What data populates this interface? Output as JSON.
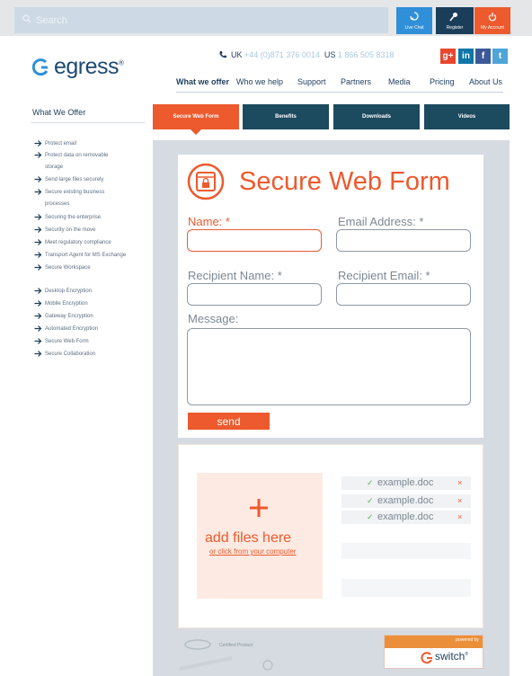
{
  "topbar": {
    "search_placeholder": "Search",
    "live_chat": "Live Chat",
    "register": "Register",
    "my_account": "My Account"
  },
  "header": {
    "logo_text": "egress",
    "phone_uk_label": "UK",
    "phone_uk": "+44 (0)871 376 0014",
    "phone_us_label": "US",
    "phone_us": "1 866 505 8318",
    "social": [
      "g+",
      "in",
      "f",
      "t"
    ]
  },
  "nav": {
    "items": [
      "What we offer",
      "Who we help",
      "Support",
      "Partners",
      "Media",
      "Pricing",
      "About Us"
    ]
  },
  "sidebar": {
    "title": "What We Offer",
    "items": [
      "Protect email",
      "Protect data on removable",
      "storage",
      "Send large files securely",
      "Secure existing business",
      "processes",
      "Securing the enterprise",
      "Security on the move",
      "Meet regulatory compliance",
      "Transport Agent for MS Exchange",
      "Secure Workspace",
      "Desktop Encryption",
      "Mobile Encryption",
      "Gateway Encryption",
      "Automated Encryption",
      "Secure Web Form",
      "Secure Collaboration"
    ]
  },
  "tabs": [
    "Secure Web Form",
    "Benefits",
    "Downloads",
    "Videos"
  ],
  "form": {
    "title": "Secure Web Form",
    "name_label": "Name: *",
    "email_label": "Email Address: *",
    "recipient_name_label": "Recipient Name: *",
    "recipient_email_label": "Recipient Email: *",
    "message_label": "Message:",
    "name_value": "",
    "email_value": "",
    "recipient_name_value": "",
    "recipient_email_value": "",
    "message_value": "",
    "send_label": "send"
  },
  "upload": {
    "add_text": "add files here",
    "add_link": "or click from your computer",
    "files": [
      "example.doc",
      "example.doc",
      "example.doc"
    ],
    "remove_glyph": "×",
    "check_glyph": "✓"
  },
  "footer": {
    "cert_text": "Certified Product",
    "powered_by": "powered by",
    "switch_text": "switch"
  },
  "colors": {
    "accent": "#ec5a2e",
    "navy": "#1c4a5e",
    "panel": "#d5dbe1",
    "chat_blue": "#2f8fd8"
  },
  "icons": {
    "search": "search-icon",
    "chat": "chat-icon",
    "register": "key-icon",
    "account": "power-icon",
    "phone": "phone-icon",
    "form": "secure-form-icon",
    "add": "plus-icon",
    "arrow": "arrow-right-icon"
  }
}
